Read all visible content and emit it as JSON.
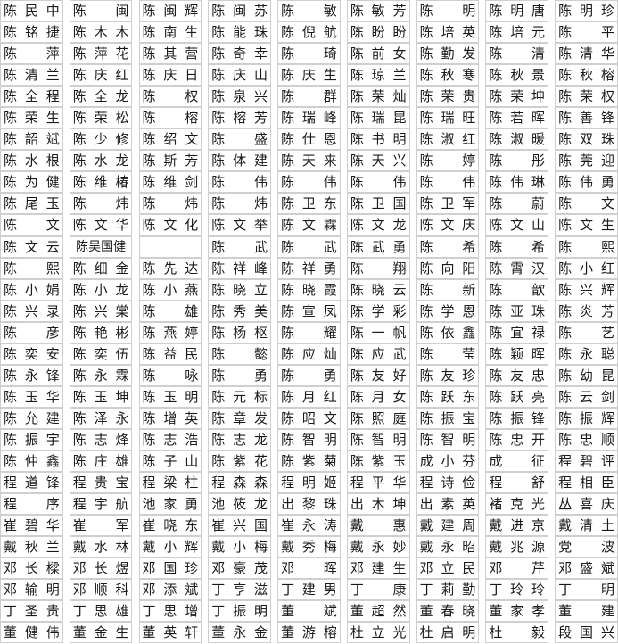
{
  "page": {
    "kind": "name-roster-grid",
    "columns": 9,
    "rows": 30,
    "grid_line_color": "#cfcfcf",
    "text_color": "#1a1a1a",
    "background_color": "#ffffff"
  },
  "grid": {
    "rows": [
      [
        "陈民中",
        "陈闽",
        "陈闽辉",
        "陈闽苏",
        "陈敏",
        "陈敏芳",
        "陈明",
        "陈明唐",
        "陈明珍"
      ],
      [
        "陈铭捷",
        "陈木木",
        "陈南生",
        "陈能珠",
        "陈倪航",
        "陈盼盼",
        "陈培英",
        "陈培元",
        "陈平"
      ],
      [
        "陈萍",
        "陈萍花",
        "陈其营",
        "陈奇幸",
        "陈琦",
        "陈前女",
        "陈勤发",
        "陈清",
        "陈清华"
      ],
      [
        "陈清兰",
        "陈庆红",
        "陈庆日",
        "陈庆山",
        "陈庆生",
        "陈琼兰",
        "陈秋寒",
        "陈秋景",
        "陈秋榕"
      ],
      [
        "陈全程",
        "陈全龙",
        "陈权",
        "陈泉兴",
        "陈群",
        "陈荣灿",
        "陈荣贵",
        "陈荣坤",
        "陈荣权"
      ],
      [
        "陈荣生",
        "陈荣松",
        "陈榕",
        "陈榕芳",
        "陈瑞峰",
        "陈瑞昆",
        "陈瑞旺",
        "陈若晖",
        "陈善锋"
      ],
      [
        "陈韶斌",
        "陈少修",
        "陈绍文",
        "陈盛",
        "陈仕恩",
        "陈书明",
        "陈淑红",
        "陈淑暖",
        "陈双珠"
      ],
      [
        "陈水根",
        "陈水龙",
        "陈斯芳",
        "陈体建",
        "陈天来",
        "陈天兴",
        "陈婷",
        "陈彤",
        "陈莞迎"
      ],
      [
        "陈为健",
        "陈维椿",
        "陈维剑",
        "陈伟",
        "陈伟",
        "陈伟",
        "陈伟",
        "陈伟琳",
        "陈伟勇"
      ],
      [
        "陈尾玉",
        "陈炜",
        "陈炜",
        "陈炜",
        "陈卫东",
        "陈卫国",
        "陈卫军",
        "陈蔚",
        "陈文"
      ],
      [
        "陈文",
        "陈文华",
        "陈文化",
        "陈文举",
        "陈文霖",
        "陈文龙",
        "陈文庆",
        "陈文山",
        "陈文生"
      ],
      [
        "陈文云",
        "陈吴国健",
        "",
        "陈武",
        "陈武",
        "陈武勇",
        "陈希",
        "陈希",
        "陈熙"
      ],
      [
        "陈熙",
        "陈细金",
        "陈先达",
        "陈祥峰",
        "陈祥勇",
        "陈翔",
        "陈向阳",
        "陈霄汉",
        "陈小红"
      ],
      [
        "陈小娟",
        "陈小龙",
        "陈小燕",
        "陈晓立",
        "陈晓霞",
        "陈晓云",
        "陈新",
        "陈歆",
        "陈兴辉"
      ],
      [
        "陈兴录",
        "陈兴棠",
        "陈雄",
        "陈秀美",
        "陈宣凤",
        "陈学彩",
        "陈学恩",
        "陈亚珠",
        "陈炎芳"
      ],
      [
        "陈彦",
        "陈艳彬",
        "陈燕婷",
        "陈杨枢",
        "陈耀",
        "陈一帆",
        "陈依鑫",
        "陈宜禄",
        "陈艺"
      ],
      [
        "陈奕安",
        "陈奕伍",
        "陈益民",
        "陈懿",
        "陈应灿",
        "陈应武",
        "陈莹",
        "陈颖晖",
        "陈永聪"
      ],
      [
        "陈永锋",
        "陈永霖",
        "陈咏",
        "陈勇",
        "陈勇",
        "陈友好",
        "陈友珍",
        "陈友忠",
        "陈幼昆"
      ],
      [
        "陈玉华",
        "陈玉坤",
        "陈玉明",
        "陈元标",
        "陈月红",
        "陈月女",
        "陈跃东",
        "陈跃亮",
        "陈云剑"
      ],
      [
        "陈允建",
        "陈泽永",
        "陈增英",
        "陈章发",
        "陈昭文",
        "陈照庭",
        "陈振宝",
        "陈振锋",
        "陈振辉"
      ],
      [
        "陈振宇",
        "陈志烽",
        "陈志浩",
        "陈志龙",
        "陈智明",
        "陈智明",
        "陈智明",
        "陈忠开",
        "陈忠顺"
      ],
      [
        "陈仲鑫",
        "陈庄雄",
        "陈子山",
        "陈紫花",
        "陈紫菊",
        "陈紫玉",
        "成小芬",
        "成征",
        "程碧评"
      ],
      [
        "程道锋",
        "程贵宝",
        "程梁柱",
        "程森森",
        "程明姬",
        "程平华",
        "程诗俭",
        "程舒",
        "程相臣"
      ],
      [
        "程序",
        "程宇航",
        "池家勇",
        "池筱龙",
        "出黎珠",
        "出木坤",
        "出素英",
        "褚克光",
        "丛喜庆"
      ],
      [
        "崔碧华",
        "崔军",
        "崔晓东",
        "崔兴国",
        "崔永涛",
        "戴惠",
        "戴建周",
        "戴进京",
        "戴清土"
      ],
      [
        "戴秋兰",
        "戴水林",
        "戴小辉",
        "戴小梅",
        "戴秀梅",
        "戴永妙",
        "戴永昭",
        "戴兆源",
        "党波"
      ],
      [
        "邓长樑",
        "邓长煜",
        "邓国珍",
        "邓豪茂",
        "邓晖",
        "邓建生",
        "邓立民",
        "邓芹",
        "邓盛斌"
      ],
      [
        "邓输明",
        "邓顺科",
        "邓添斌",
        "丁亨滋",
        "丁建男",
        "丁康",
        "丁莉勤",
        "丁玲玲",
        "丁明"
      ],
      [
        "丁圣贵",
        "丁思雄",
        "丁思增",
        "丁振明",
        "董斌",
        "董超然",
        "董春晓",
        "董家孝",
        "董建"
      ],
      [
        "董健伟",
        "董金生",
        "董英轩",
        "董永金",
        "董游榕",
        "杜立光",
        "杜启明",
        "杜毅",
        "段国兴"
      ]
    ]
  }
}
